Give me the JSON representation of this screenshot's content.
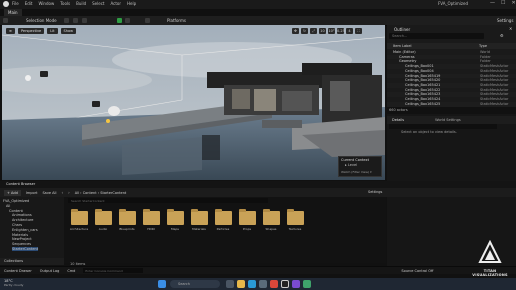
{
  "window": {
    "menu": [
      "File",
      "Edit",
      "Window",
      "Tools",
      "Build",
      "Select",
      "Actor",
      "Help"
    ],
    "project_name": "FVA_Optimized",
    "map_tab": "Main",
    "controls": [
      "—",
      "☐",
      "✕"
    ]
  },
  "toolbar": {
    "selection_mode": "Selection Mode",
    "platforms": "Platforms",
    "settings": "Settings"
  },
  "viewport": {
    "perspective": "Perspective",
    "lit": "Lit",
    "show": "Show",
    "snap_values": [
      "10",
      "10°",
      "0.25",
      "4"
    ],
    "camera_speed_label": "Current Context",
    "context_item": "Level",
    "context_footer": "Watch (Filter View) ▾"
  },
  "outliner": {
    "title": "Outliner",
    "search_placeholder": "Search...",
    "col_label": "Item Label",
    "col_type": "Type",
    "rows": [
      {
        "label": "Main (Editor)",
        "type": "World",
        "indent": 0
      },
      {
        "label": "Cameras",
        "type": "Folder",
        "indent": 1
      },
      {
        "label": "Geometry",
        "type": "Folder",
        "indent": 1
      },
      {
        "label": "Ceilings_Box001",
        "type": "StaticMeshActor",
        "indent": 2
      },
      {
        "label": "Ceilings_Box004",
        "type": "StaticMeshActor",
        "indent": 2
      },
      {
        "label": "Ceilings_Box165419",
        "type": "StaticMeshActor",
        "indent": 2
      },
      {
        "label": "Ceilings_Box165420",
        "type": "StaticMeshActor",
        "indent": 2
      },
      {
        "label": "Ceilings_Box165421",
        "type": "StaticMeshActor",
        "indent": 2
      },
      {
        "label": "Ceilings_Box165422",
        "type": "StaticMeshActor",
        "indent": 2
      },
      {
        "label": "Ceilings_Box165423",
        "type": "StaticMeshActor",
        "indent": 2
      },
      {
        "label": "Ceilings_Box165424",
        "type": "StaticMeshActor",
        "indent": 2
      },
      {
        "label": "Ceilings_Box165425",
        "type": "StaticMeshActor",
        "indent": 2
      }
    ],
    "actor_count": "660 actors"
  },
  "details": {
    "tab_details": "Details",
    "tab_world_settings": "World Settings",
    "empty_message": "Select an object to view details."
  },
  "content_browser": {
    "tab": "Content Browser",
    "add": "+ Add",
    "import": "Import",
    "save_all": "Save All",
    "path": [
      "All",
      "Content",
      "StarterContent"
    ],
    "settings": "Settings",
    "search_placeholder": "Search StarterContent",
    "tree": [
      "FVA_Optimized",
      "All",
      "Content",
      "Animations",
      "Architecture",
      "Chars",
      "Enlighten_cars",
      "Materials",
      "NewProject",
      "Sequences",
      "StarterContent"
    ],
    "folders": [
      "Architecture",
      "Audio",
      "Blueprints",
      "HDRI",
      "Maps",
      "Materials",
      "Particles",
      "Props",
      "Shapes",
      "Textures"
    ],
    "collections": "Collections",
    "item_count": "10 items"
  },
  "statusbar": {
    "content_drawer": "Content Drawer",
    "output_log": "Output Log",
    "cmd": "Cmd",
    "cmd_placeholder": "Enter Console Command",
    "source_control": "Source Control Off"
  },
  "watermark": {
    "brand": "TITAN VISUALIZATIONS"
  },
  "taskbar": {
    "weather_temp": "18°C",
    "weather_text": "Partly cloudy",
    "search": "Search"
  }
}
